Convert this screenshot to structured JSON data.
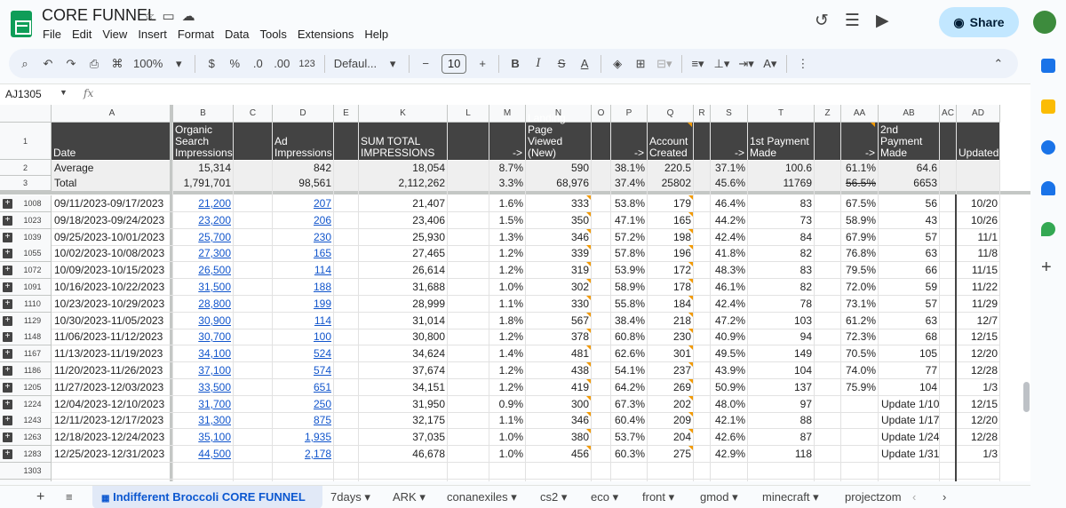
{
  "title": "CORE FUNNEL",
  "menu": [
    "File",
    "Edit",
    "View",
    "Insert",
    "Format",
    "Data",
    "Tools",
    "Extensions",
    "Help"
  ],
  "share_label": "Share",
  "toolbar": {
    "zoom": "100%",
    "currency": "$",
    "percent": "%",
    "dec_less": ".0",
    "dec_more": ".00",
    "fmt_num": "123",
    "font": "Defaul...",
    "font_size": "10"
  },
  "namebox": "AJ1305",
  "fx": "fx",
  "columns": [
    "A",
    "B",
    "C",
    "D",
    "E",
    "K",
    "L",
    "M",
    "N",
    "O",
    "P",
    "Q",
    "R",
    "S",
    "T",
    "Z",
    "AA",
    "AB",
    "AC",
    "AD"
  ],
  "headers": {
    "date": "Date",
    "organic": "Organic Search Impressions",
    "ad": "Ad Impressions",
    "sum": "SUM TOTAL IMPRESSIONS",
    "arrow1": "->",
    "landing": "Landing Page Viewed (New)",
    "arrow2": "->",
    "account": "Account Created",
    "arrow3": "->",
    "first": "1st Payment Made",
    "arrow4": "->",
    "second": "2nd Payment Made",
    "updated": "Updated"
  },
  "average": {
    "label": "Average",
    "b": "15,314",
    "d": "842",
    "k": "18,054",
    "m": "8.7%",
    "n": "590",
    "p": "38.1%",
    "q": "220.5",
    "s": "37.1%",
    "t": "100.6",
    "aa": "61.1%",
    "ab": "64.6"
  },
  "total": {
    "label": "Total",
    "b": "1,791,701",
    "d": "98,561",
    "k": "2,112,262",
    "m": "3.3%",
    "n": "68,976",
    "p": "37.4%",
    "q": "25802",
    "s": "45.6%",
    "t": "11769",
    "aa": "56.5%",
    "ab": "6653"
  },
  "rows": [
    {
      "row": "1008",
      "date": "09/11/2023-09/17/2023",
      "b": "21,200",
      "d": "207",
      "k": "21,407",
      "m": "1.6%",
      "n": "333",
      "p": "53.8%",
      "q": "179",
      "s": "46.4%",
      "t": "83",
      "aa": "67.5%",
      "ab": "56",
      "ad": "10/20"
    },
    {
      "row": "1023",
      "date": "09/18/2023-09/24/2023",
      "b": "23,200",
      "d": "206",
      "k": "23,406",
      "m": "1.5%",
      "n": "350",
      "p": "47.1%",
      "q": "165",
      "s": "44.2%",
      "t": "73",
      "aa": "58.9%",
      "ab": "43",
      "ad": "10/26"
    },
    {
      "row": "1039",
      "date": "09/25/2023-10/01/2023",
      "b": "25,700",
      "d": "230",
      "k": "25,930",
      "m": "1.3%",
      "n": "346",
      "p": "57.2%",
      "q": "198",
      "s": "42.4%",
      "t": "84",
      "aa": "67.9%",
      "ab": "57",
      "ad": "11/1"
    },
    {
      "row": "1055",
      "date": "10/02/2023-10/08/2023",
      "b": "27,300",
      "d": "165",
      "k": "27,465",
      "m": "1.2%",
      "n": "339",
      "p": "57.8%",
      "q": "196",
      "s": "41.8%",
      "t": "82",
      "aa": "76.8%",
      "ab": "63",
      "ad": "11/8"
    },
    {
      "row": "1072",
      "date": "10/09/2023-10/15/2023",
      "b": "26,500",
      "d": "114",
      "k": "26,614",
      "m": "1.2%",
      "n": "319",
      "p": "53.9%",
      "q": "172",
      "s": "48.3%",
      "t": "83",
      "aa": "79.5%",
      "ab": "66",
      "ad": "11/15"
    },
    {
      "row": "1091",
      "date": "10/16/2023-10/22/2023",
      "b": "31,500",
      "d": "188",
      "k": "31,688",
      "m": "1.0%",
      "n": "302",
      "p": "58.9%",
      "q": "178",
      "s": "46.1%",
      "t": "82",
      "aa": "72.0%",
      "ab": "59",
      "ad": "11/22"
    },
    {
      "row": "1110",
      "date": "10/23/2023-10/29/2023",
      "b": "28,800",
      "d": "199",
      "k": "28,999",
      "m": "1.1%",
      "n": "330",
      "p": "55.8%",
      "q": "184",
      "s": "42.4%",
      "t": "78",
      "aa": "73.1%",
      "ab": "57",
      "ad": "11/29"
    },
    {
      "row": "1129",
      "date": "10/30/2023-11/05/2023",
      "b": "30,900",
      "d": "114",
      "k": "31,014",
      "m": "1.8%",
      "n": "567",
      "p": "38.4%",
      "q": "218",
      "s": "47.2%",
      "t": "103",
      "aa": "61.2%",
      "ab": "63",
      "ad": "12/7"
    },
    {
      "row": "1148",
      "date": "11/06/2023-11/12/2023",
      "b": "30,700",
      "d": "100",
      "k": "30,800",
      "m": "1.2%",
      "n": "378",
      "p": "60.8%",
      "q": "230",
      "s": "40.9%",
      "t": "94",
      "aa": "72.3%",
      "ab": "68",
      "ad": "12/15"
    },
    {
      "row": "1167",
      "date": "11/13/2023-11/19/2023",
      "b": "34,100",
      "d": "524",
      "k": "34,624",
      "m": "1.4%",
      "n": "481",
      "p": "62.6%",
      "q": "301",
      "s": "49.5%",
      "t": "149",
      "aa": "70.5%",
      "ab": "105",
      "ad": "12/20"
    },
    {
      "row": "1186",
      "date": "11/20/2023-11/26/2023",
      "b": "37,100",
      "d": "574",
      "k": "37,674",
      "m": "1.2%",
      "n": "438",
      "p": "54.1%",
      "q": "237",
      "s": "43.9%",
      "t": "104",
      "aa": "74.0%",
      "ab": "77",
      "ad": "12/28"
    },
    {
      "row": "1205",
      "date": "11/27/2023-12/03/2023",
      "b": "33,500",
      "d": "651",
      "k": "34,151",
      "m": "1.2%",
      "n": "419",
      "p": "64.2%",
      "q": "269",
      "s": "50.9%",
      "t": "137",
      "aa": "75.9%",
      "ab": "104",
      "ad": "1/3"
    },
    {
      "row": "1224",
      "date": "12/04/2023-12/10/2023",
      "b": "31,700",
      "d": "250",
      "k": "31,950",
      "m": "0.9%",
      "n": "300",
      "p": "67.3%",
      "q": "202",
      "s": "48.0%",
      "t": "97",
      "aa": "",
      "ab": "Update 1/10",
      "ad": "12/15"
    },
    {
      "row": "1243",
      "date": "12/11/2023-12/17/2023",
      "b": "31,300",
      "d": "875",
      "k": "32,175",
      "m": "1.1%",
      "n": "346",
      "p": "60.4%",
      "q": "209",
      "s": "42.1%",
      "t": "88",
      "aa": "",
      "ab": "Update 1/17",
      "ad": "12/20"
    },
    {
      "row": "1263",
      "date": "12/18/2023-12/24/2023",
      "b": "35,100",
      "d": "1,935",
      "k": "37,035",
      "m": "1.0%",
      "n": "380",
      "p": "53.7%",
      "q": "204",
      "s": "42.6%",
      "t": "87",
      "aa": "",
      "ab": "Update 1/24",
      "ad": "12/28"
    },
    {
      "row": "1283",
      "date": "12/25/2023-12/31/2023",
      "b": "44,500",
      "d": "2,178",
      "k": "46,678",
      "m": "1.0%",
      "n": "456",
      "p": "60.3%",
      "q": "275",
      "s": "42.9%",
      "t": "118",
      "aa": "",
      "ab": "Update 1/31",
      "ad": "1/3"
    }
  ],
  "empty_rows": [
    "1303",
    "1304"
  ],
  "header_row_nums": [
    "1",
    "2",
    "3"
  ],
  "tabs": [
    "Indifferent Broccoli CORE FUNNEL",
    "7days",
    "ARK",
    "conanexiles",
    "cs2",
    "eco",
    "front",
    "gmod",
    "minecraft",
    "projectzom"
  ]
}
